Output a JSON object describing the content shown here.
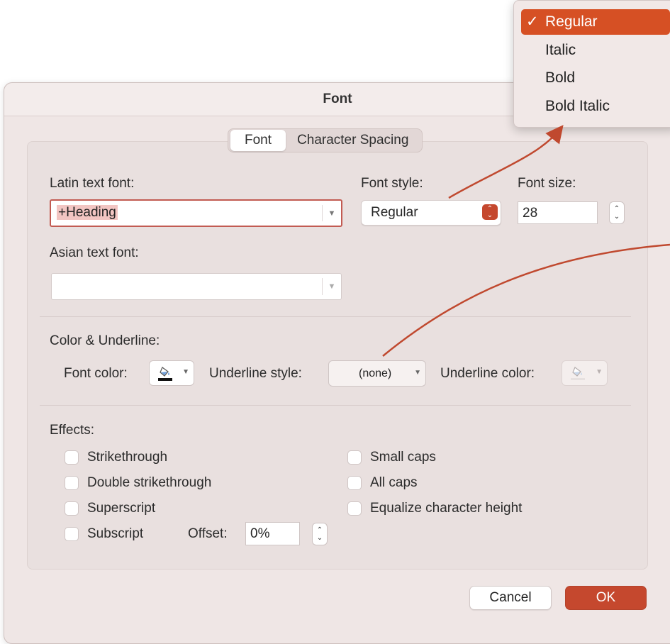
{
  "dialog": {
    "title": "Font"
  },
  "tabs": [
    {
      "label": "Font",
      "active": true
    },
    {
      "label": "Character Spacing",
      "active": false
    }
  ],
  "latin_font": {
    "label": "Latin text font:",
    "value": "+Heading"
  },
  "font_style": {
    "label": "Font style:",
    "value": "Regular"
  },
  "font_size": {
    "label": "Font size:",
    "value": "28"
  },
  "asian_font": {
    "label": "Asian text font:",
    "value": ""
  },
  "color_underline": {
    "section_label": "Color & Underline:",
    "font_color_label": "Font color:",
    "underline_style_label": "Underline style:",
    "underline_style_value": "(none)",
    "underline_color_label": "Underline color:"
  },
  "effects": {
    "section_label": "Effects:",
    "left": [
      {
        "label": "Strikethrough",
        "checked": false
      },
      {
        "label": "Double strikethrough",
        "checked": false
      },
      {
        "label": "Superscript",
        "checked": false
      },
      {
        "label": "Subscript",
        "checked": false
      }
    ],
    "right": [
      {
        "label": "Small caps",
        "checked": false
      },
      {
        "label": "All caps",
        "checked": false
      },
      {
        "label": "Equalize character height",
        "checked": false
      }
    ],
    "offset_label": "Offset:",
    "offset_value": "0%"
  },
  "buttons": {
    "cancel": "Cancel",
    "ok": "OK"
  },
  "style_menu": {
    "items": [
      {
        "label": "Regular",
        "selected": true
      },
      {
        "label": "Italic",
        "selected": false
      },
      {
        "label": "Bold",
        "selected": false
      },
      {
        "label": "Bold Italic",
        "selected": false
      }
    ]
  },
  "colors": {
    "accent": "#c5482e",
    "menu_highlight": "#d65024",
    "annotation_arrow": "#c0492f",
    "dialog_bg": "#efe6e5"
  }
}
